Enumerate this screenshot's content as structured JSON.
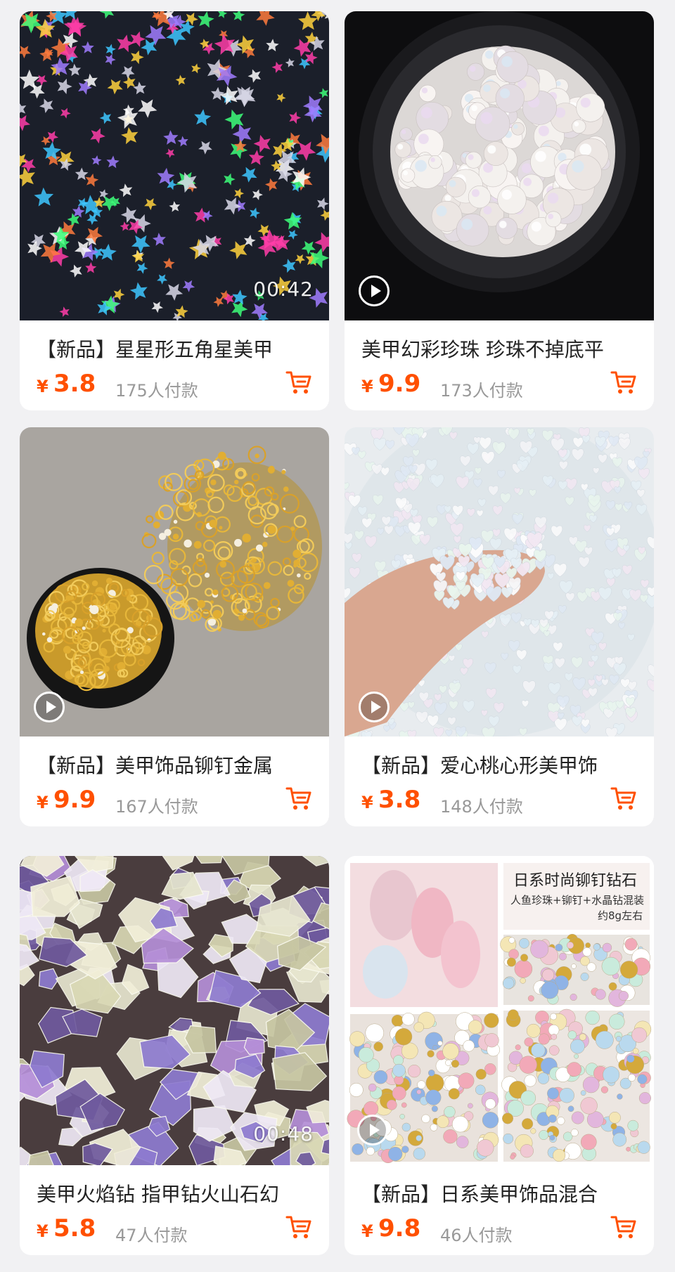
{
  "products": [
    {
      "title": "【新品】星星形五角星美甲",
      "currency": "¥",
      "price": "3.8",
      "sales": "175人付款",
      "duration": "00:42",
      "image": "holographic-star-glitter"
    },
    {
      "title": "美甲幻彩珍珠 珍珠不掉底平",
      "currency": "¥",
      "price": "9.9",
      "sales": "173人付款",
      "image": "iridescent-pearls-jar"
    },
    {
      "title": "【新品】美甲饰品铆钉金属",
      "currency": "¥",
      "price": "9.9",
      "sales": "167人付款",
      "image": "gold-metal-studs"
    },
    {
      "title": "【新品】爱心桃心形美甲饰",
      "currency": "¥",
      "price": "3.8",
      "sales": "148人付款",
      "image": "heart-glitter-finger"
    },
    {
      "title": "美甲火焰钻 指甲钻火山石幻",
      "currency": "¥",
      "price": "5.8",
      "sales": "47人付款",
      "duration": "00:48",
      "image": "flame-crystal-rhinestones"
    },
    {
      "title": "【新品】日系美甲饰品混合",
      "currency": "¥",
      "price": "9.8",
      "sales": "46人付款",
      "image": "japanese-mixed-decor-collage",
      "overlay_text": {
        "line1": "日系时尚铆钉钻石",
        "line2": "人鱼珍珠+铆钉+水晶钻混装",
        "line3": "约8g左右"
      }
    }
  ],
  "colors": {
    "price": "#ff5000",
    "sales": "#999999",
    "background": "#f1f1f3"
  },
  "icons": {
    "cart": "shopping-cart-icon",
    "play": "play-icon"
  }
}
